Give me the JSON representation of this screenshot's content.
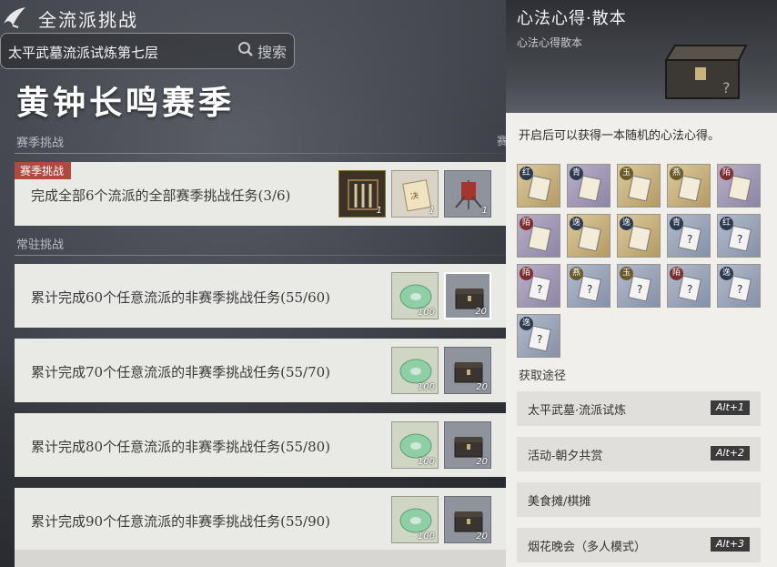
{
  "header": {
    "title": "全流派挑战",
    "search_value": "太平武墓流派试炼第七层",
    "search_label": "搜索"
  },
  "season": {
    "title": "黄钟长鸣赛季",
    "section_label": "赛季挑战",
    "edge_char": "赛"
  },
  "season_card": {
    "tag": "赛季挑战",
    "text": "完成全部6个流派的全部赛季挑战任务(3/6)",
    "rewards": [
      {
        "icon": "weapons-icon",
        "count": "1"
      },
      {
        "icon": "scroll-icon",
        "count": "1"
      },
      {
        "icon": "banner-icon",
        "count": "1"
      }
    ]
  },
  "regular": {
    "section_label": "常驻挑战",
    "cards": [
      {
        "text": "累计完成60个任意流派的非赛季挑战任务(55/60)",
        "reward1": "100",
        "reward2": "20"
      },
      {
        "text": "累计完成70个任意流派的非赛季挑战任务(55/70)",
        "reward1": "100",
        "reward2": "20"
      },
      {
        "text": "累计完成80个任意流派的非赛季挑战任务(55/80)",
        "reward1": "100",
        "reward2": "20"
      },
      {
        "text": "累计完成90个任意流派的非赛季挑战任务(55/90)",
        "reward1": "100",
        "reward2": "20"
      }
    ]
  },
  "panel": {
    "title": "心法心得·散本",
    "subtitle": "心法心得散本",
    "description": "开启后可以获得一本随机的心法心得。",
    "books": [
      {
        "badge": "红",
        "style": "gold"
      },
      {
        "badge": "青",
        "style": "purple"
      },
      {
        "badge": "玉",
        "style": "gold"
      },
      {
        "badge": "燕",
        "style": "gold"
      },
      {
        "badge": "陌",
        "style": "purple"
      },
      {
        "badge": "陌",
        "style": "purple"
      },
      {
        "badge": "逸",
        "style": "gold"
      },
      {
        "badge": "逸",
        "style": "gold"
      },
      {
        "badge": "青",
        "style": "blue"
      },
      {
        "badge": "红",
        "style": "blue"
      },
      {
        "badge": "陌",
        "style": "purple"
      },
      {
        "badge": "燕",
        "style": "blue"
      },
      {
        "badge": "玉",
        "style": "blue"
      },
      {
        "badge": "陌",
        "style": "blue"
      },
      {
        "badge": "逸",
        "style": "blue"
      },
      {
        "badge": "逸",
        "style": "blue"
      }
    ],
    "acquire_label": "获取途径",
    "acquire": [
      {
        "name": "太平武墓·流派试炼",
        "key": "Alt+1"
      },
      {
        "name": "活动-朝夕共赏",
        "key": "Alt+2"
      },
      {
        "name": "美食摊/棋摊",
        "key": ""
      },
      {
        "name": "烟花晚会（多人模式）",
        "key": "Alt+3"
      }
    ]
  },
  "colors": {
    "tag_red": "#b04a3e",
    "card_bg": "#e9e9e6",
    "panel_bg": "#f0efeb"
  }
}
